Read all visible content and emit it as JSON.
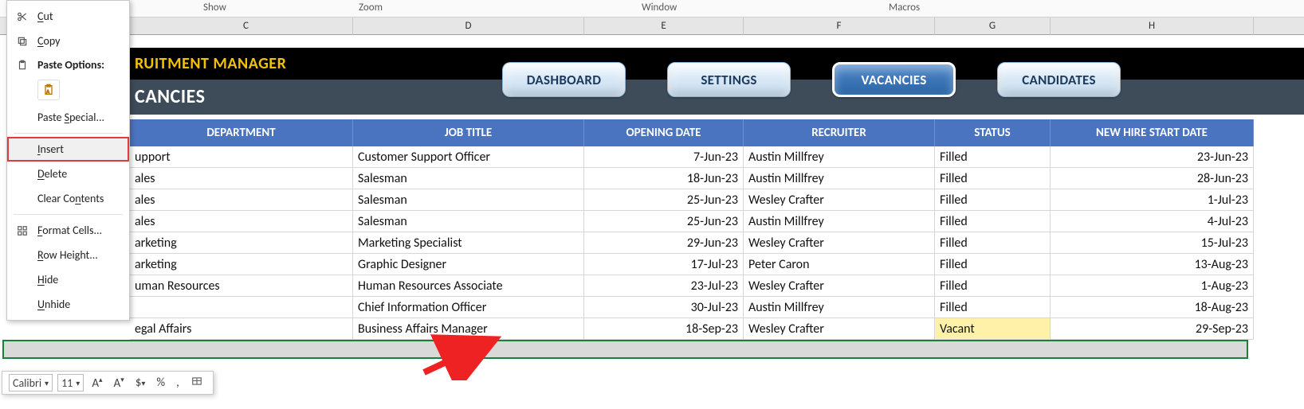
{
  "ribbon_groups": {
    "show": "Show",
    "zoom": "Zoom",
    "window": "Window",
    "macros": "Macros"
  },
  "col_letters": [
    "C",
    "D",
    "E",
    "F",
    "G",
    "H"
  ],
  "context_menu": {
    "cut": "Cut",
    "copy": "Copy",
    "paste_options": "Paste Options:",
    "paste_special": "Paste Special...",
    "insert": "Insert",
    "delete": "Delete",
    "clear_contents": "Clear Contents",
    "format_cells": "Format Cells...",
    "row_height": "Row Height...",
    "hide": "Hide",
    "unhide": "Unhide"
  },
  "title": "RUITMENT MANAGER",
  "subtitle": "CANCIES",
  "nav": {
    "dashboard": "DASHBOARD",
    "settings": "SETTINGS",
    "vacancies": "VACANCIES",
    "candidates": "CANDIDATES"
  },
  "headers": {
    "dept": "DEPARTMENT",
    "job": "JOB TITLE",
    "open": "OPENING DATE",
    "rec": "RECRUITER",
    "status": "STATUS",
    "start": "NEW HIRE START DATE"
  },
  "rows": [
    {
      "dept": "upport",
      "job": "Customer Support Officer",
      "open": "7-Jun-23",
      "rec": "Austin Millfrey",
      "status": "Filled",
      "start": "23-Jun-23"
    },
    {
      "dept": "ales",
      "job": "Salesman",
      "open": "18-Jun-23",
      "rec": "Austin Millfrey",
      "status": "Filled",
      "start": "28-Jun-23"
    },
    {
      "dept": "ales",
      "job": "Salesman",
      "open": "25-Jun-23",
      "rec": "Wesley Crafter",
      "status": "Filled",
      "start": "1-Jul-23"
    },
    {
      "dept": "ales",
      "job": "Salesman",
      "open": "25-Jun-23",
      "rec": "Austin Millfrey",
      "status": "Filled",
      "start": "4-Jul-23"
    },
    {
      "dept": "arketing",
      "job": "Marketing Specialist",
      "open": "29-Jun-23",
      "rec": "Wesley Crafter",
      "status": "Filled",
      "start": "15-Jul-23"
    },
    {
      "dept": "arketing",
      "job": "Graphic Designer",
      "open": "17-Jul-23",
      "rec": "Peter Caron",
      "status": "Filled",
      "start": "13-Aug-23"
    },
    {
      "dept": "uman Resources",
      "job": "Human Resources Associate",
      "open": "23-Jul-23",
      "rec": "Wesley Crafter",
      "status": "Filled",
      "start": "1-Aug-23"
    },
    {
      "dept": "",
      "job": "Chief Information Officer",
      "open": "30-Jul-23",
      "rec": "Austin Millfrey",
      "status": "Filled",
      "start": "18-Aug-23"
    },
    {
      "dept": "egal Affairs",
      "job": "Business Affairs Manager",
      "open": "18-Sep-23",
      "rec": "Wesley Crafter",
      "status": "Vacant",
      "start": "29-Sep-23"
    }
  ],
  "toolbar": {
    "font": "Calibri",
    "size": "11"
  }
}
